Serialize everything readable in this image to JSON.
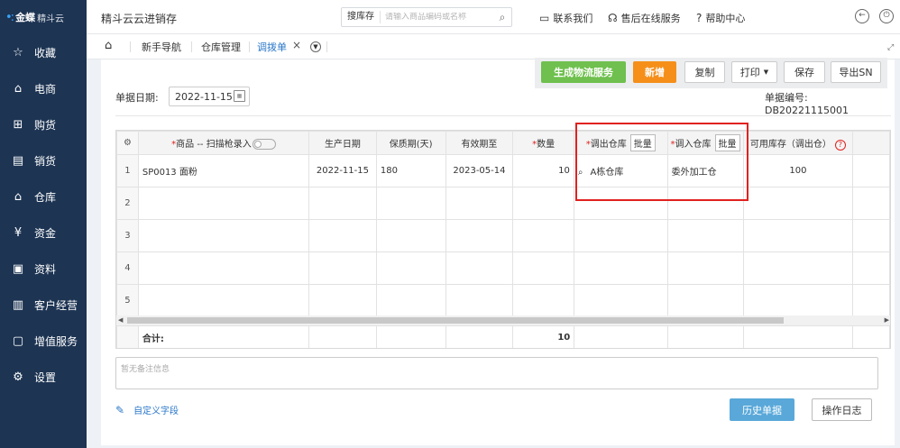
{
  "sidebar": {
    "logo_brand": "金蝶",
    "logo_product": "精斗云",
    "items": [
      {
        "label": "收藏",
        "icon": "star-icon",
        "glyph": "☆"
      },
      {
        "label": "电商",
        "icon": "shopping-bag-icon",
        "glyph": "⌂"
      },
      {
        "label": "购货",
        "icon": "cart-icon",
        "glyph": "⊞"
      },
      {
        "label": "销货",
        "icon": "receipt-icon",
        "glyph": "▤"
      },
      {
        "label": "仓库",
        "icon": "warehouse-icon",
        "glyph": "⌂"
      },
      {
        "label": "资金",
        "icon": "currency-icon",
        "glyph": "¥"
      },
      {
        "label": "资料",
        "icon": "document-icon",
        "glyph": "▣"
      },
      {
        "label": "客户经营",
        "icon": "chart-icon",
        "glyph": "▥"
      },
      {
        "label": "增值服务",
        "icon": "service-icon",
        "glyph": "▢"
      },
      {
        "label": "设置",
        "icon": "gear-icon",
        "glyph": "⚙"
      }
    ]
  },
  "topbar": {
    "title": "精斗云云进销存",
    "search_scope": "搜库存",
    "search_placeholder": "请输入商品编码或名称",
    "contact_us": "联系我们",
    "after_sales": "售后在线服务",
    "help_center": "帮助中心"
  },
  "tabs": {
    "guide": "新手导航",
    "warehouse_mgmt": "仓库管理",
    "transfer": "调拨单"
  },
  "toolbar": {
    "logistics": "生成物流服务",
    "new": "新增",
    "copy": "复制",
    "print": "打印",
    "save": "保存",
    "export_sn": "导出SN"
  },
  "form": {
    "date_label": "单据日期:",
    "date_value": "2022-11-15",
    "docno_label": "单据编号:",
    "docno_value": "DB20221115001"
  },
  "grid": {
    "headers": {
      "product": "商品 -- 扫描枪录入",
      "prod_date": "生产日期",
      "shelf_life": "保质期(天)",
      "expiry": "有效期至",
      "qty": "数量",
      "out_wh": "调出仓库",
      "in_wh": "调入仓库",
      "batch": "批量",
      "avail_stock": "可用库存（调出仓）"
    },
    "rows": [
      {
        "no": "1",
        "product": "SP0013 面粉",
        "prod_date": "2022-11-15",
        "shelf_life": "180",
        "expiry": "2023-05-14",
        "qty": "10",
        "out_wh": "A栋仓库",
        "in_wh": "委外加工仓",
        "avail_stock": "100"
      },
      {
        "no": "2"
      },
      {
        "no": "3"
      },
      {
        "no": "4"
      },
      {
        "no": "5"
      }
    ],
    "total_label": "合计:",
    "total_qty": "10"
  },
  "remark": {
    "placeholder": "暂无备注信息"
  },
  "footer": {
    "custom_field": "自定义字段",
    "history": "历史单据",
    "log": "操作日志"
  },
  "colors": {
    "sidebar_bg": "#1d3453",
    "accent": "#2a77c9",
    "highlight": "#e0221f",
    "logistics": "#6fc04e",
    "new": "#f58f1a"
  }
}
